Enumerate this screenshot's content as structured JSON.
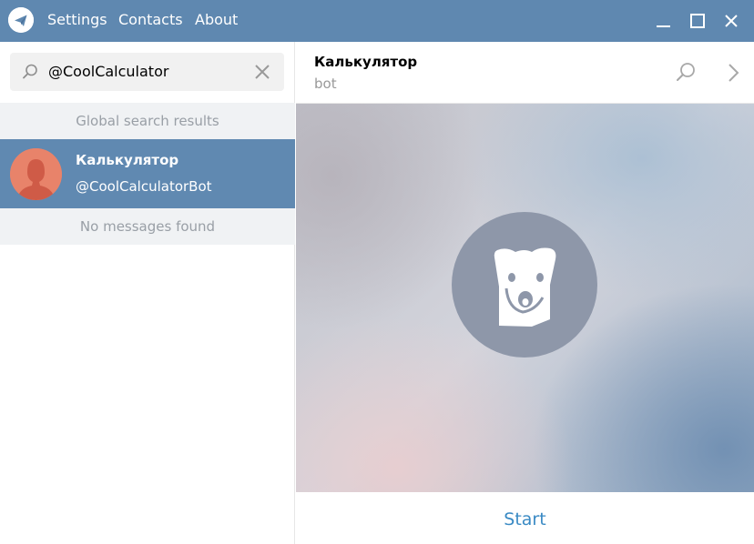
{
  "menu": {
    "settings": "Settings",
    "contacts": "Contacts",
    "about": "About"
  },
  "search": {
    "value": "@CoolCalculator"
  },
  "results": {
    "global_header": "Global search results",
    "items": [
      {
        "name": "Калькулятор",
        "username": "@CoolCalculatorBot"
      }
    ],
    "messages_header": "No messages found"
  },
  "chat": {
    "title": "Калькулятор",
    "status": "bot",
    "start_label": "Start"
  },
  "icons": {
    "app": "telegram-logo-icon",
    "search": "search-icon",
    "clear": "close-icon",
    "minimize": "minimize-icon",
    "maximize": "maximize-icon",
    "close": "close-icon",
    "chat_search": "search-icon",
    "chat_more": "chevron-right-icon",
    "bot_avatar": "dog-face-icon"
  },
  "colors": {
    "titlebar": "#5f88b0",
    "selected_row": "#6089b1",
    "accent": "#3a8ac4",
    "avatar_bg": "#e8836a",
    "bot_avatar_bg": "#8e97a9"
  }
}
